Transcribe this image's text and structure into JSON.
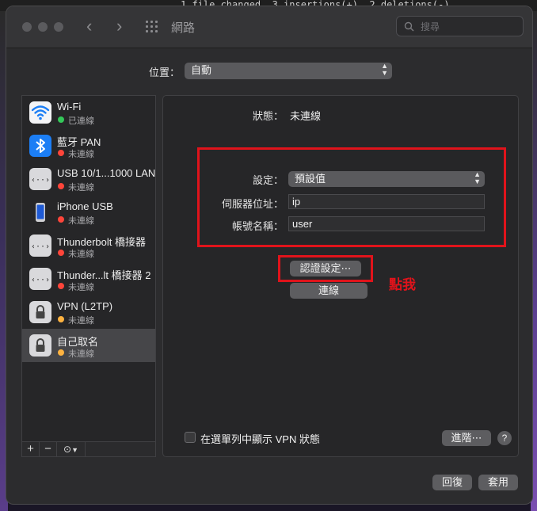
{
  "background": {
    "terminal_text": "1 file changed, 3 insertions(+), 2 deletions(-)"
  },
  "window": {
    "title": "網路",
    "search_placeholder": "搜尋"
  },
  "location": {
    "label": "位置：",
    "value": "自動"
  },
  "services": [
    {
      "name": "Wi-Fi",
      "status": "已連線",
      "status_color": "#34c759",
      "icon": "wifi-icon"
    },
    {
      "name": "藍牙 PAN",
      "status": "未連線",
      "status_color": "#ff453a",
      "icon": "bluetooth-icon"
    },
    {
      "name": "USB 10/1...1000 LAN",
      "status": "未連線",
      "status_color": "#ff453a",
      "icon": "ethernet-icon"
    },
    {
      "name": "iPhone USB",
      "status": "未連線",
      "status_color": "#ff453a",
      "icon": "iphone-icon"
    },
    {
      "name": "Thunderbolt 橋接器",
      "status": "未連線",
      "status_color": "#ff453a",
      "icon": "ethernet-icon"
    },
    {
      "name": "Thunder...lt 橋接器 2",
      "status": "未連線",
      "status_color": "#ff453a",
      "icon": "ethernet-icon"
    },
    {
      "name": "VPN (L2TP)",
      "status": "未連線",
      "status_color": "#ffb340",
      "icon": "lock-icon"
    },
    {
      "name": "自己取名",
      "status": "未連線",
      "status_color": "#ffb340",
      "icon": "lock-icon",
      "selected": true
    }
  ],
  "sidebar_buttons": {
    "add": "+",
    "remove": "−",
    "action": "⊙"
  },
  "detail": {
    "status_label": "狀態：",
    "status_value": "未連線",
    "config_label": "設定：",
    "config_value": "預設值",
    "server_label": "伺服器位址：",
    "server_value": "ip",
    "account_label": "帳號名稱：",
    "account_value": "user",
    "auth_button": "認證設定⋯",
    "connect_button": "連線",
    "annotation": "點我",
    "show_vpn_label": "在選單列中顯示 VPN 狀態",
    "advanced_button": "進階⋯",
    "help": "?"
  },
  "footer": {
    "revert": "回復",
    "apply": "套用"
  },
  "colors": {
    "annotation_red": "#e0131b"
  }
}
